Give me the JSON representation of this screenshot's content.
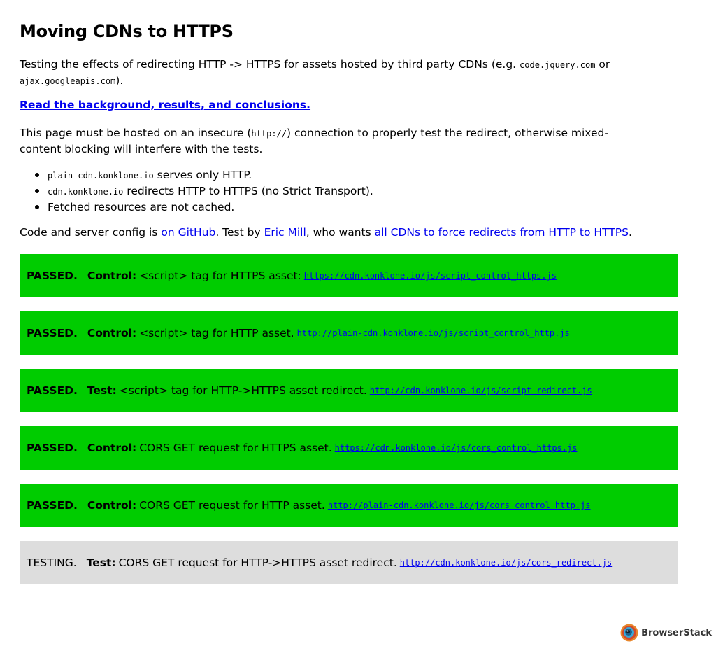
{
  "title": "Moving CDNs to HTTPS",
  "intro": {
    "text1": "Testing the effects of redirecting HTTP -> HTTPS for assets hosted by third party CDNs (e.g.",
    "code1": "code.jquery.com",
    "or": "or",
    "code2": "ajax.googleapis.com",
    "end": ")."
  },
  "background_link": "Read the background, results, and conclusions.",
  "hosting": {
    "text1": "This page must be hosted on an insecure (",
    "code": "http://",
    "text2": ") connection to properly test the redirect, otherwise mixed-content blocking will interfere with the tests."
  },
  "notes": [
    {
      "code": "plain-cdn.konklone.io",
      "text": " serves only HTTP."
    },
    {
      "code": "cdn.konklone.io",
      "text": " redirects HTTP to HTTPS (no Strict Transport)."
    },
    {
      "code": "",
      "text": "Fetched resources are not cached."
    }
  ],
  "credits": {
    "text1": "Code and server config is ",
    "github_link": "on GitHub",
    "text2": ". Test by ",
    "author_link": "Eric Mill",
    "text3": ", who wants ",
    "cdn_link": "all CDNs to force redirects from HTTP to HTTPS",
    "text4": "."
  },
  "tests": [
    {
      "status": "PASSED.",
      "kind": "Control:",
      "desc": "<script> tag for HTTPS asset:",
      "url": "https://cdn.konklone.io/js/script_control_https.js",
      "state": "passed"
    },
    {
      "status": "PASSED.",
      "kind": "Control:",
      "desc": "<script> tag for HTTP asset.",
      "url": "http://plain-cdn.konklone.io/js/script_control_http.js",
      "state": "passed"
    },
    {
      "status": "PASSED.",
      "kind": "Test:",
      "desc": "<script> tag for HTTP->HTTPS asset redirect.",
      "url": "http://cdn.konklone.io/js/script_redirect.js",
      "state": "passed"
    },
    {
      "status": "PASSED.",
      "kind": "Control:",
      "desc": "CORS GET request for HTTPS asset.",
      "url": "https://cdn.konklone.io/js/cors_control_https.js",
      "state": "passed"
    },
    {
      "status": "PASSED.",
      "kind": "Control:",
      "desc": "CORS GET request for HTTP asset.",
      "url": "http://plain-cdn.konklone.io/js/cors_control_http.js",
      "state": "passed"
    },
    {
      "status": "TESTING.",
      "kind": "Test:",
      "desc": "CORS GET request for HTTP->HTTPS asset redirect.",
      "url": "http://cdn.konklone.io/js/cors_redirect.js",
      "state": "testing"
    }
  ],
  "colors": {
    "passed": "#00cc00",
    "testing": "#dddddd",
    "link": "#0000ee"
  },
  "brand": {
    "name": "BrowserStack",
    "icon": "browserstack-logo-icon"
  }
}
